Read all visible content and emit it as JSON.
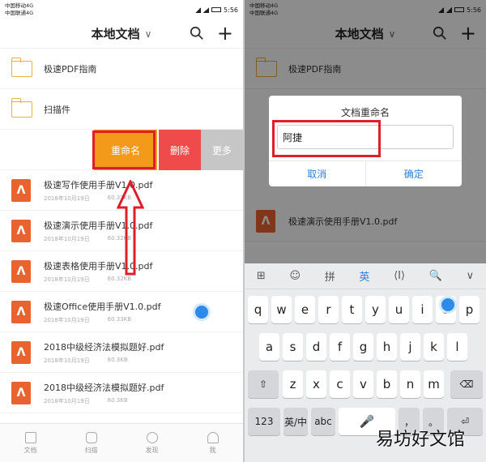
{
  "left": {
    "status": {
      "carrier_l1": "中国移动4G",
      "carrier_l2": "中国联通4G",
      "time": "5:56"
    },
    "header": {
      "title": "本地文档",
      "chevron": "∨",
      "plus": "+"
    },
    "folders": [
      {
        "name": "极速PDF指南"
      },
      {
        "name": "扫描件"
      }
    ],
    "swipe": {
      "rename": "重命名",
      "delete": "删除",
      "more": "更多"
    },
    "files": [
      {
        "name": "极速写作使用手册V1.0.pdf",
        "date": "2018年10月19日",
        "size": "60.33KB"
      },
      {
        "name": "极速演示使用手册V1.0.pdf",
        "date": "2018年10月19日",
        "size": "60.32KB"
      },
      {
        "name": "极速表格使用手册V1.0.pdf",
        "date": "2018年10月19日",
        "size": "60.32KB"
      },
      {
        "name": "极速Office使用手册V1.0.pdf",
        "date": "2018年10月19日",
        "size": "60.33KB"
      },
      {
        "name": "2018中级经济法模拟题好.pdf",
        "date": "2018年10月19日",
        "size": "60.3KB"
      },
      {
        "name": "2018中级经济法模拟题好.pdf",
        "date": "2018年10月19日",
        "size": "60.3KB"
      }
    ],
    "tabs": [
      {
        "label": "文档"
      },
      {
        "label": "扫描"
      },
      {
        "label": "发现"
      },
      {
        "label": "我"
      }
    ]
  },
  "right": {
    "status": {
      "carrier_l1": "中国移动4G",
      "carrier_l2": "中国联通4G",
      "time": "5:56"
    },
    "header": {
      "title": "本地文档",
      "chevron": "∨",
      "plus": "+"
    },
    "folders": [
      {
        "name": "极速PDF指南"
      }
    ],
    "files": [
      {
        "name": "极速演示使用手册V1.0.pdf"
      }
    ],
    "dialog": {
      "title": "文档重命名",
      "input_value": "阿捷",
      "cancel": "取消",
      "confirm": "确定"
    },
    "keyboard": {
      "toolbar": [
        "⊞",
        "☺",
        "拼",
        "英",
        "⟨I⟩",
        "🔍",
        "∨"
      ],
      "row1": [
        "q",
        "w",
        "e",
        "r",
        "t",
        "y",
        "u",
        "i",
        "o",
        "p"
      ],
      "row2": [
        "a",
        "s",
        "d",
        "f",
        "g",
        "h",
        "j",
        "k",
        "l"
      ],
      "row3": [
        "⇧",
        "z",
        "x",
        "c",
        "v",
        "b",
        "n",
        "m",
        "⌫"
      ],
      "row4": [
        "123",
        "英/中",
        "abc",
        "🎤",
        "，",
        "。",
        "⏎"
      ]
    }
  },
  "watermark": "易坊好文馆",
  "colors": {
    "rename": "#f39a1a",
    "delete": "#ef4b4b",
    "more": "#c6c6c6",
    "highlight": "#e01e2a",
    "accent": "#2d7fd6"
  }
}
